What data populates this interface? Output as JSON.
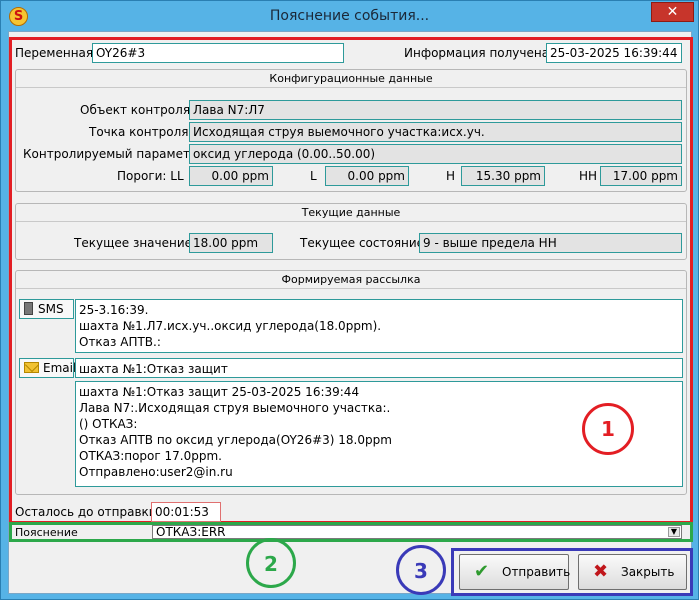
{
  "window": {
    "title": "Пояснение события...",
    "app_icon_glyph": "S",
    "close_glyph": "✕"
  },
  "header": {
    "variable_label": "Переменная",
    "variable_value": "OY26#3",
    "info_label": "Информация получена",
    "info_value": "25-03-2025 16:39:44"
  },
  "config": {
    "title": "Конфигурационные данные",
    "object_label": "Объект контроля",
    "object_value": "Лава N7:Л7",
    "point_label": "Точка контроля",
    "point_value": "Исходящая струя выемочного участка:исх.уч.",
    "param_label": "Контролируемый параметр",
    "param_value": "оксид углерода (0.00..50.00)",
    "thresholds_label": "Пороги: LL",
    "ll_value": "0.00 ppm",
    "l_label": "L",
    "l_value": "0.00 ppm",
    "h_label": "H",
    "h_value": "15.30 ppm",
    "hh_label": "HH",
    "hh_value": "17.00 ppm"
  },
  "current": {
    "title": "Текущие данные",
    "value_label": "Текущее значение",
    "value": "18.00 ppm",
    "state_label": "Текущее состояние",
    "state": "9 - выше предела HH"
  },
  "mailing": {
    "title": "Формируемая рассылка",
    "sms_label": "SMS",
    "sms_icon": "phone-icon",
    "sms_text": "25-3.16:39.\nшахта №1.Л7.исх.уч..оксид углерода(18.0ppm).\nОтказ АПТВ.:",
    "email_label": "Email",
    "email_icon": "envelope-icon",
    "email_subject": "шахта №1:Отказ защит",
    "email_body": "шахта №1:Отказ защит 25-03-2025 16:39:44\nЛава N7:.Исходящая струя выемочного участка:.\n() ОТКАЗ:\nОтказ АПТВ по оксид углерода(OY26#3) 18.0ppm\nОТКАЗ:порог 17.0ppm.\nОтправлено:user2@in.ru",
    "remaining_label": "Осталось до отправки",
    "remaining_value": "00:01:53"
  },
  "explanation": {
    "label": "Пояснение",
    "value": "ОТКАЗ:ERR",
    "arrow": "▼"
  },
  "annotations": {
    "one": "1",
    "two": "2",
    "three": "3",
    "red": "#e31e24",
    "green": "#2ca84a",
    "blue": "#3a3ab8"
  },
  "buttons": {
    "send_label": "Отправить",
    "send_icon": "✔",
    "close_label": "Закрыть",
    "close_icon": "✖"
  }
}
